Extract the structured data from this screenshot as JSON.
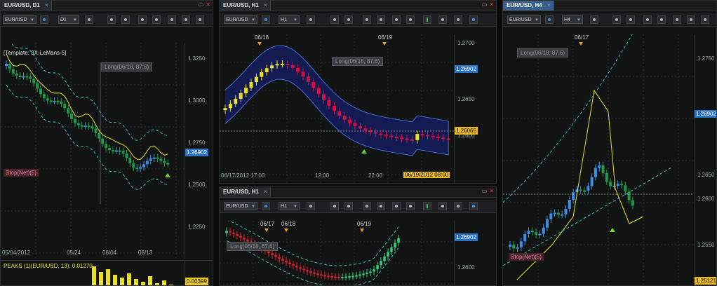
{
  "windows": [
    {
      "id": "d1",
      "tab": "EUR/USD, D1",
      "symbol": "EUR/USD",
      "timeframe": "D1",
      "template_label": "[Template: 3X-LeMans-5]",
      "long_label": "Long(06/18, 87.6)",
      "stop_label": "Stop(Net)(5)",
      "price_ticks": [
        "1.3250",
        "1.3000",
        "1.2750",
        "1.2500",
        "1.2250"
      ],
      "current_price": "1.26902",
      "date_ticks": [
        "05/04/2012",
        "05/24",
        "06/04",
        "06/13"
      ],
      "indicator_label": "PEAKS (1)(EUR/USD, 13): 0.01270",
      "indicator_value": "0.00399"
    },
    {
      "id": "h1a",
      "tab": "EUR/USD, H1",
      "symbol": "EUR/USD",
      "timeframe": "H1",
      "long_label": "Long(06/18, 87.6)",
      "top_dates": [
        "06/18",
        "06/19"
      ],
      "price_ticks": [
        "1.2700",
        "1.2650",
        "1.2600"
      ],
      "current_price": "1.26902",
      "last_price": "1.26065",
      "x_ticks": [
        "06/17/2012 17:00",
        "12:00",
        "22:00"
      ],
      "cursor_time": "06/19/2012 08:00"
    },
    {
      "id": "h1b",
      "tab": "EUR/USD, H1",
      "symbol": "EUR/USD",
      "timeframe": "H1",
      "long_label": "Long(06/18, 87.6)",
      "top_dates": [
        "06/17",
        "06/18",
        "06/19"
      ],
      "price_ticks": [
        "1.2600"
      ],
      "current_price": "1.26902"
    },
    {
      "id": "h4",
      "tab": "EUR/USD, H4",
      "symbol": "EUR/USD",
      "timeframe": "H4",
      "long_label": "Long(06/18, 87.6)",
      "stop_label": "Stop(Net)(5)",
      "top_dates": [
        "06/17"
      ],
      "price_ticks": [
        "1.2750",
        "1.2650",
        "1.2600",
        "1.2550"
      ],
      "current_price": "1.26902",
      "bottom_price": "1.25121"
    }
  ],
  "colors": {
    "up": "#3a8ee6",
    "down": "#1e9a4a",
    "h1_up": "#e8e030",
    "h1_down": "#d01040",
    "band_fill": "#141a52",
    "trail": "#e8e020",
    "channel": "#2fb8b0",
    "accent": "#3a5f86"
  }
}
